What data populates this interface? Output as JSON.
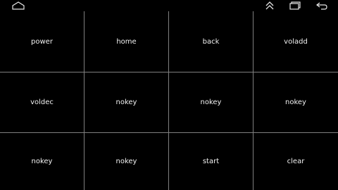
{
  "status_bar": {
    "icons": [
      "home-outline-icon",
      "double-chevron-up-icon",
      "recents-icon",
      "back-arrow-icon"
    ]
  },
  "keys": [
    {
      "label": "power"
    },
    {
      "label": "home"
    },
    {
      "label": "back"
    },
    {
      "label": "voladd"
    },
    {
      "label": "voldec"
    },
    {
      "label": "nokey"
    },
    {
      "label": "nokey"
    },
    {
      "label": "nokey"
    },
    {
      "label": "nokey"
    },
    {
      "label": "nokey"
    },
    {
      "label": "start"
    },
    {
      "label": "clear"
    }
  ],
  "colors": {
    "background": "#000000",
    "grid_line": "#7f7f7f",
    "text": "#f2f2f2",
    "icon": "#e6e6e6"
  }
}
